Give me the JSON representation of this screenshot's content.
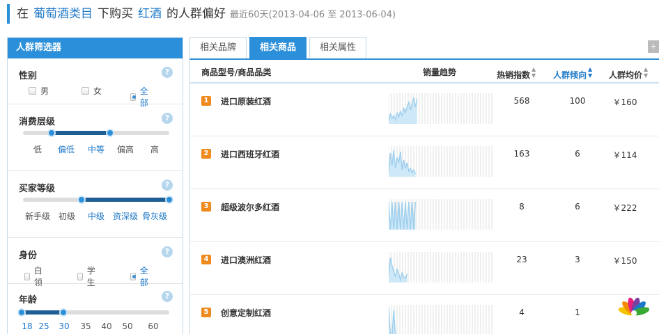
{
  "header": {
    "p1": "在",
    "category": "葡萄酒类目",
    "p2": "下购买",
    "keyword": "红酒",
    "p3": "的人群偏好",
    "range": "最近60天(2013-04-06 至 2013-06-04)"
  },
  "sidebar": {
    "title": "人群筛选器",
    "help": "?",
    "gender": {
      "label": "性别",
      "options": [
        {
          "label": "男",
          "checked": false
        },
        {
          "label": "女",
          "checked": false
        },
        {
          "label": "全部",
          "checked": true
        }
      ]
    },
    "consumption": {
      "label": "消费层级",
      "ticks": [
        "低",
        "偏低",
        "中等",
        "偏高",
        "高"
      ],
      "selected_range": [
        "偏低",
        "中等"
      ]
    },
    "buyer_level": {
      "label": "买家等级",
      "ticks": [
        "新手级",
        "初级",
        "中级",
        "资深级",
        "骨灰级"
      ],
      "selected_range": [
        "中级",
        "骨灰级"
      ]
    },
    "identity": {
      "label": "身份",
      "options": [
        {
          "label": "白领",
          "checked": false
        },
        {
          "label": "学生",
          "checked": false
        },
        {
          "label": "全部",
          "checked": true
        }
      ]
    },
    "age": {
      "label": "年龄",
      "ticks": [
        "18",
        "25",
        "30",
        "35",
        "40",
        "50",
        "60"
      ],
      "selected_range": [
        "18",
        "30"
      ]
    }
  },
  "tabs": [
    {
      "label": "相关品牌",
      "active": false
    },
    {
      "label": "相关商品",
      "active": true
    },
    {
      "label": "相关属性",
      "active": false
    }
  ],
  "tab_more": "+",
  "table": {
    "headers": {
      "product": "商品型号/商品品类",
      "trend": "销量趋势",
      "hot": "热销指数",
      "tendency": "人群倾向",
      "avg_price": "人群均价"
    },
    "sorted_column": "tendency",
    "rows": [
      {
        "rank": "1",
        "name": "进口原装红酒",
        "hot": "568",
        "tendency": "100",
        "price": "￥160",
        "trend": [
          0.1,
          0.35,
          0.2,
          0.3,
          0.15,
          0.4,
          0.25,
          0.45,
          0.3,
          0.55,
          0.4,
          0.6,
          0.8,
          0.5,
          0.7,
          0.95,
          0.6,
          0.9
        ]
      },
      {
        "rank": "2",
        "name": "进口西班牙红酒",
        "hot": "163",
        "tendency": "6",
        "price": "￥114",
        "trend": [
          0.2,
          0.85,
          0.4,
          0.95,
          0.3,
          0.7,
          0.5,
          0.9,
          0.25,
          0.6,
          0.3,
          0.5,
          0.2,
          0.3,
          0.15,
          0.25,
          0.1
        ]
      },
      {
        "rank": "3",
        "name": "超级波尔多红酒",
        "hot": "8",
        "tendency": "6",
        "price": "￥222",
        "trend": [
          1,
          0,
          1,
          0,
          1,
          0,
          1,
          0,
          1,
          0,
          1,
          0,
          1,
          0,
          1,
          0,
          1
        ]
      },
      {
        "rank": "4",
        "name": "进口澳洲红酒",
        "hot": "23",
        "tendency": "3",
        "price": "￥150",
        "trend": [
          0.3,
          0.9,
          0.6,
          0.4,
          0.2,
          0.5,
          0.3,
          0.1,
          0.35,
          0.2,
          0.15,
          0.3
        ]
      },
      {
        "rank": "5",
        "name": "创意定制红酒",
        "hot": "4",
        "tendency": "1",
        "price": "",
        "trend": [
          1,
          0,
          0,
          0.9,
          0,
          0,
          0,
          0
        ]
      }
    ]
  }
}
